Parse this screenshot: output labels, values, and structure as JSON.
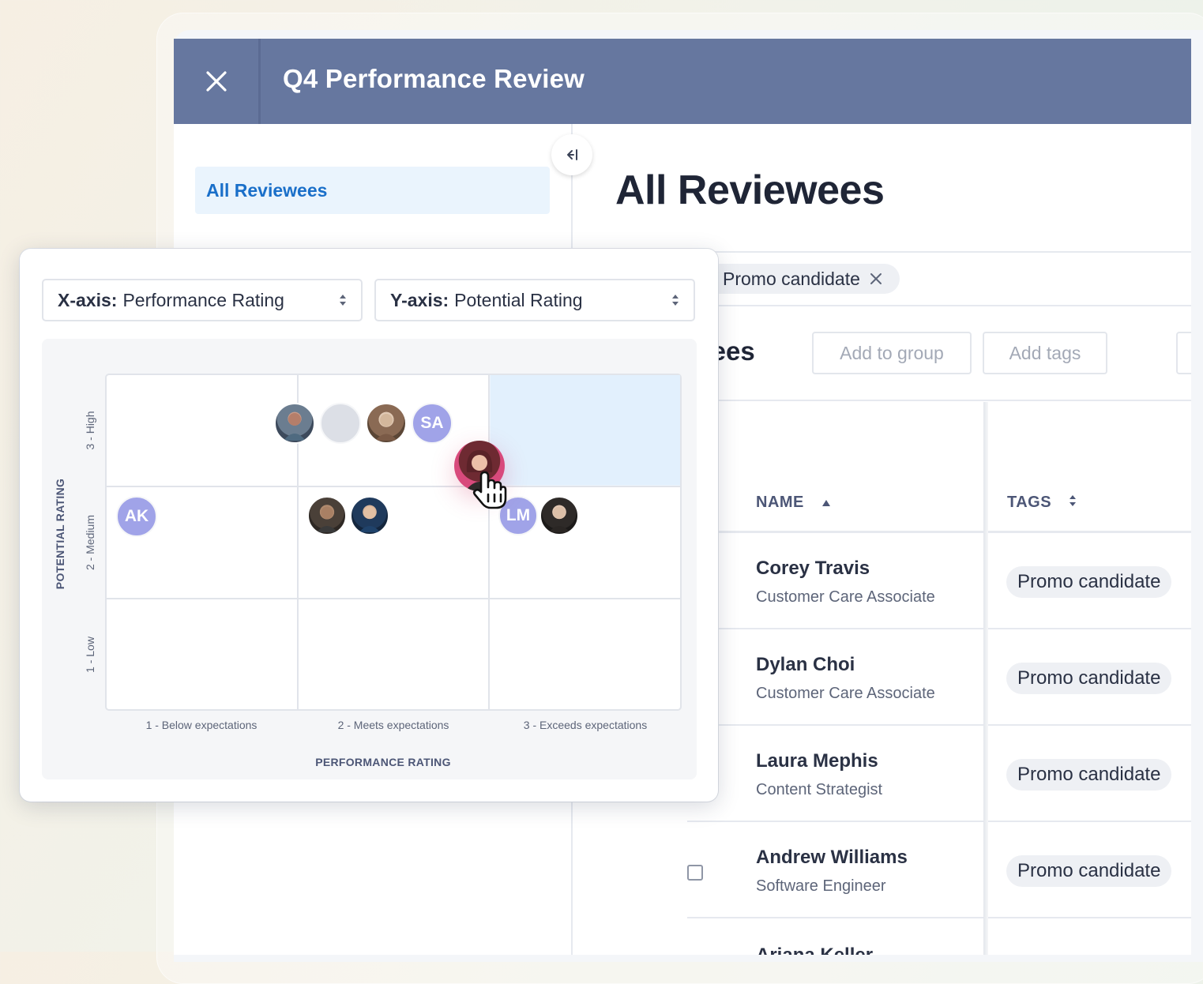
{
  "window": {
    "title": "Q4 Performance Review"
  },
  "sidebar": {
    "items": [
      {
        "label": "All Reviewees",
        "active": true
      }
    ]
  },
  "main": {
    "page_title": "All Reviewees",
    "filter": {
      "chip_label": "Promo candidate"
    },
    "actions": {
      "reviewees_label": "wees",
      "add_to_group": "Add to group",
      "add_tags": "Add tags"
    },
    "table": {
      "columns": {
        "name": "NAME",
        "tags": "TAGS"
      },
      "rows": [
        {
          "name": "Corey Travis",
          "role": "Customer Care Associate",
          "tag": "Promo candidate"
        },
        {
          "name": "Dylan Choi",
          "role": "Customer Care Associate",
          "tag": "Promo candidate"
        },
        {
          "name": "Laura Mephis",
          "role": "Content Strategist",
          "tag": "Promo candidate"
        },
        {
          "name": "Andrew Williams",
          "role": "Software Engineer",
          "tag": "Promo candidate"
        },
        {
          "name": "Ariana Keller",
          "role": "",
          "tag": ""
        }
      ]
    }
  },
  "grid_popup": {
    "x_select": {
      "prefix": "X-axis:",
      "value": "Performance Rating"
    },
    "y_select": {
      "prefix": "Y-axis:",
      "value": "Potential Rating"
    },
    "initials": {
      "sa": "SA",
      "ak": "AK",
      "lm": "LM"
    },
    "highlight_color": "#e2f0fd",
    "avatar_color": "#a0a3e8"
  },
  "chart_data": {
    "type": "scatter",
    "xlabel": "PERFORMANCE RATING",
    "ylabel": "POTENTIAL RATING",
    "x_categories": [
      "1 - Below expectations",
      "2 - Meets expectations",
      "3 - Exceeds expectations"
    ],
    "y_categories": [
      "1 - Low",
      "2 - Medium",
      "3 - High"
    ],
    "highlighted_cell": {
      "x": 3,
      "y": 3
    },
    "points": [
      {
        "x": 2,
        "y": 3,
        "label": ""
      },
      {
        "x": 2,
        "y": 3,
        "label": ""
      },
      {
        "x": 2,
        "y": 3,
        "label": ""
      },
      {
        "x": 2,
        "y": 3,
        "label": "SA"
      },
      {
        "x": 1,
        "y": 2,
        "label": "AK"
      },
      {
        "x": 2,
        "y": 2,
        "label": ""
      },
      {
        "x": 2,
        "y": 2,
        "label": ""
      },
      {
        "x": 3,
        "y": 2,
        "label": "LM"
      },
      {
        "x": 3,
        "y": 2,
        "label": ""
      }
    ]
  }
}
